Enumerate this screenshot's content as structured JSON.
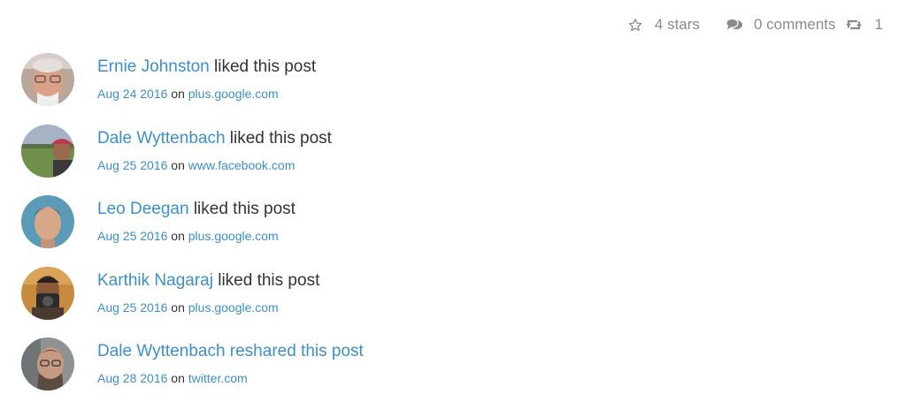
{
  "stats": {
    "stars": "4 stars",
    "comments": "0 comments",
    "reshares": "1",
    "icon_color": "#8a8a8a"
  },
  "link_color": "#3b8fd0",
  "activities": [
    {
      "name": "Ernie Johnston",
      "action": "liked this post",
      "date": "Aug 24 2016",
      "on": "on",
      "source": "plus.google.com",
      "avatar_icon": "avatar-photo"
    },
    {
      "name": "Dale Wyttenbach",
      "action": "liked this post",
      "date": "Aug 25 2016",
      "on": "on",
      "source": "www.facebook.com",
      "avatar_icon": "avatar-photo"
    },
    {
      "name": "Leo Deegan",
      "action": "liked this post",
      "date": "Aug 25 2016",
      "on": "on",
      "source": "plus.google.com",
      "avatar_icon": "avatar-photo"
    },
    {
      "name": "Karthik Nagaraj",
      "action": "liked this post",
      "date": "Aug 25 2016",
      "on": "on",
      "source": "plus.google.com",
      "avatar_icon": "avatar-photo"
    },
    {
      "name": "Dale Wyttenbach reshared this post",
      "action": "",
      "date": "Aug 28 2016",
      "on": "on",
      "source": "twitter.com",
      "avatar_icon": "avatar-photo"
    }
  ]
}
